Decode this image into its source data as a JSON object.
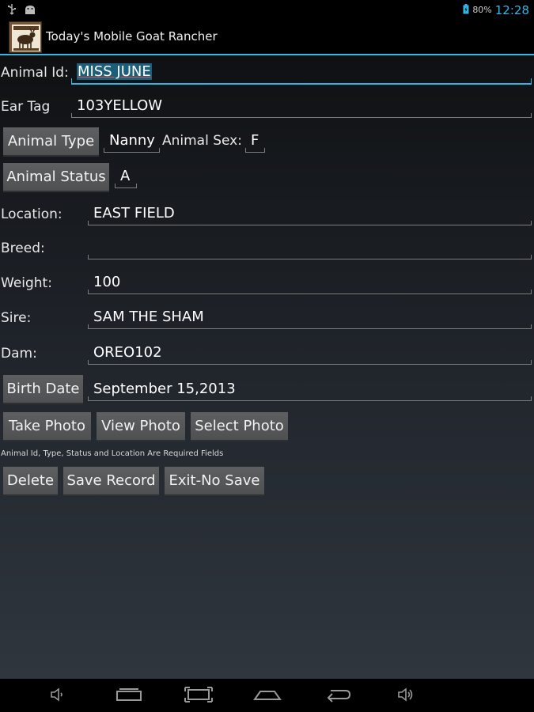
{
  "status_bar": {
    "battery_percent": "80%",
    "time": "12:28",
    "icons": [
      "usb-icon",
      "android-debug-icon",
      "battery-icon"
    ]
  },
  "app_bar": {
    "title": "Today's Mobile Goat Rancher",
    "icon": "goat-app-icon"
  },
  "form": {
    "animal_id": {
      "label": "Animal Id:",
      "value": "MISS JUNE"
    },
    "ear_tag": {
      "label": "Ear Tag",
      "value": "103YELLOW"
    },
    "animal_type": {
      "button": "Animal Type",
      "value": "Nanny"
    },
    "animal_sex": {
      "label": "Animal Sex:",
      "value": "F"
    },
    "animal_status": {
      "button": "Animal Status",
      "value": "A"
    },
    "location": {
      "label": "Location:",
      "value": "EAST FIELD"
    },
    "breed": {
      "label": "Breed:",
      "value": ""
    },
    "weight": {
      "label": "Weight:",
      "value": "100"
    },
    "sire": {
      "label": "Sire:",
      "value": "SAM THE SHAM"
    },
    "dam": {
      "label": "Dam:",
      "value": "OREO102"
    },
    "birth_date": {
      "button": "Birth Date",
      "value": "September 15,2013"
    }
  },
  "photo_buttons": {
    "take": "Take Photo",
    "view": "View Photo",
    "select": "Select Photo"
  },
  "required_note": "Animal Id, Type, Status and Location Are Required Fields",
  "actions": {
    "delete": "Delete",
    "save": "Save Record",
    "exit": "Exit-No Save"
  },
  "nav_bar": {
    "icons": [
      "volume-down-icon",
      "recent-apps-icon",
      "screenshot-icon",
      "home-icon",
      "back-icon",
      "volume-up-icon"
    ]
  },
  "colors": {
    "accent": "#33b5e5",
    "button": "#55585a",
    "background": "#1a1d21"
  }
}
